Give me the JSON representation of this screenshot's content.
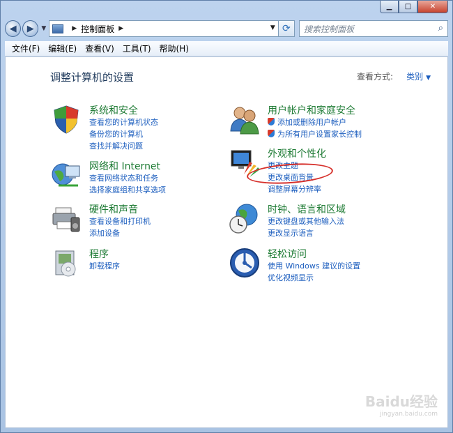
{
  "window": {
    "caption": {
      "minimize_glyph": "▁",
      "maximize_glyph": "□",
      "close_glyph": "✕"
    }
  },
  "address": {
    "back_glyph": "◀",
    "forward_glyph": "▶",
    "path": "控制面板",
    "separator_glyph": "▶",
    "dropdown_glyph": "▼",
    "refresh_glyph": "⟳",
    "search_placeholder": "搜索控制面板",
    "search_icon": "search-icon"
  },
  "menubar": {
    "items": [
      "文件(F)",
      "编辑(E)",
      "查看(V)",
      "工具(T)",
      "帮助(H)"
    ]
  },
  "main": {
    "heading": "调整计算机的设置",
    "view_by_label": "查看方式:",
    "view_by_value": "类别",
    "view_by_arrow": "▼",
    "categories": [
      {
        "title": "系统和安全",
        "icon": "shield-flag-icon",
        "links": [
          "查看您的计算机状态",
          "备份您的计算机",
          "查找并解决问题"
        ]
      },
      {
        "title": "网络和 Internet",
        "icon": "network-globe-icon",
        "links": [
          "查看网络状态和任务",
          "选择家庭组和共享选项"
        ]
      },
      {
        "title": "硬件和声音",
        "icon": "printer-speaker-icon",
        "links": [
          "查看设备和打印机",
          "添加设备"
        ]
      },
      {
        "title": "程序",
        "icon": "programs-box-icon",
        "links": [
          "卸载程序"
        ]
      },
      {
        "title": "用户帐户和家庭安全",
        "icon": "users-icon",
        "links": [
          "添加或删除用户帐户",
          "为所有用户设置家长控制"
        ]
      },
      {
        "title": "外观和个性化",
        "icon": "monitor-palette-icon",
        "links": [
          "更改主题",
          "更改桌面背景",
          "调整屏幕分辨率"
        ]
      },
      {
        "title": "时钟、语言和区域",
        "icon": "clock-globe-icon",
        "links": [
          "更改键盘或其他输入法",
          "更改显示语言"
        ]
      },
      {
        "title": "轻松访问",
        "icon": "ease-of-access-icon",
        "links": [
          "使用 Windows 建议的设置",
          "优化视频显示"
        ]
      }
    ]
  },
  "watermark": {
    "text": "Baidu经验",
    "sub": "jingyan.baidu.com"
  },
  "colors": {
    "category_title": "#1e7b34",
    "link": "#1e5fbf",
    "highlight_ellipse": "#d6302b"
  }
}
